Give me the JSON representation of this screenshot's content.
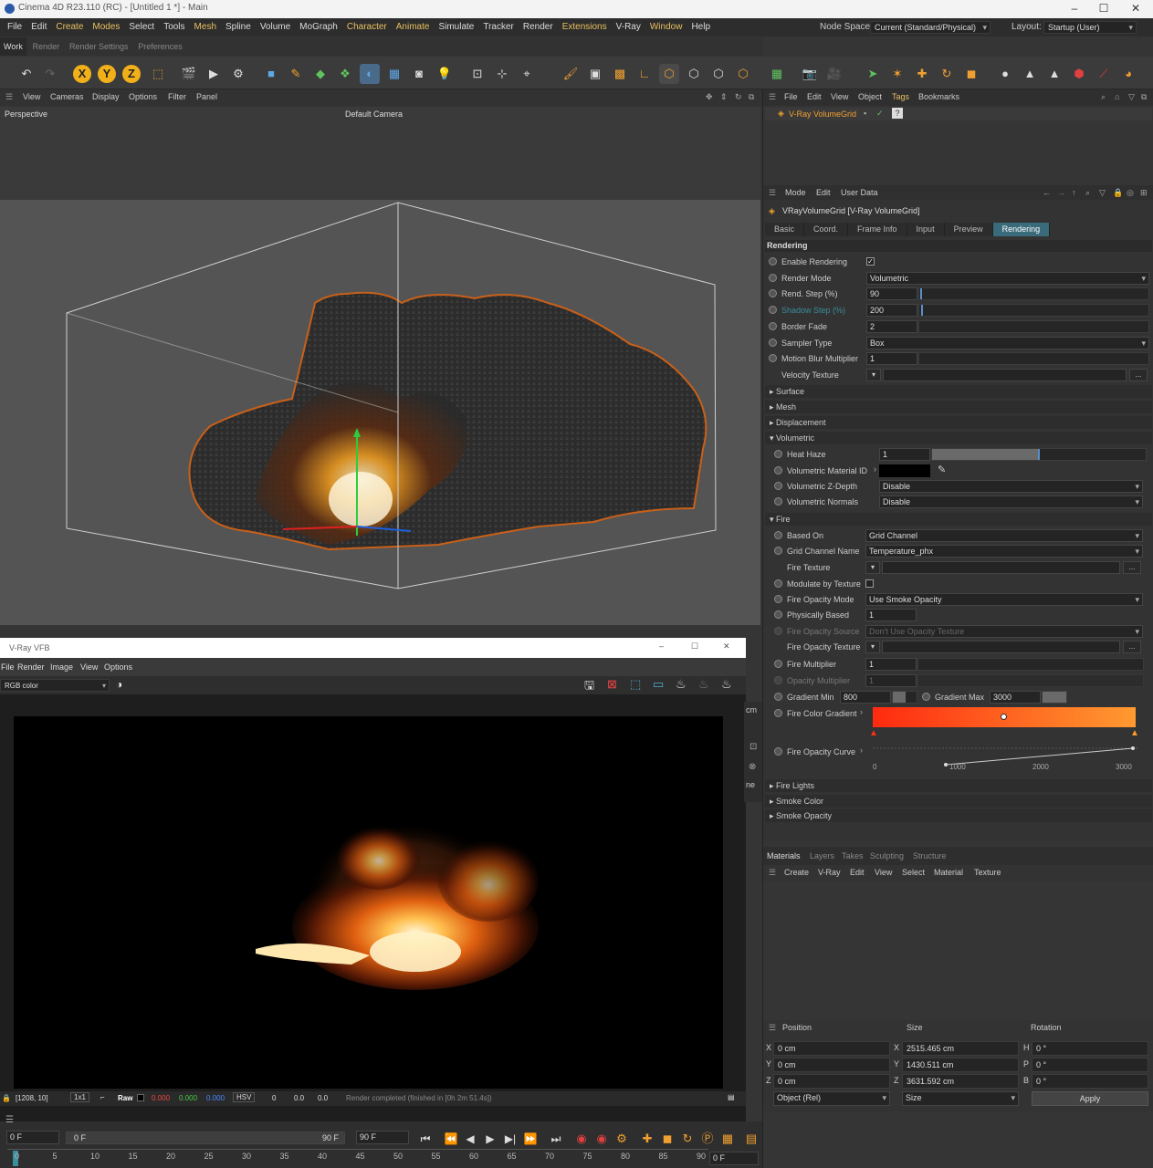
{
  "app": {
    "title": "Cinema 4D R23.110 (RC) - [Untitled 1 *] - Main"
  },
  "menubar": {
    "items": [
      "File",
      "Edit",
      "Create",
      "Modes",
      "Select",
      "Tools",
      "Mesh",
      "Spline",
      "Volume",
      "MoGraph",
      "Character",
      "Animate",
      "Simulate",
      "Tracker",
      "Render",
      "Extensions",
      "V-Ray",
      "Window",
      "Help"
    ],
    "node_space_label": "Node Space:",
    "node_space_value": "Current (Standard/Physical)",
    "layout_label": "Layout:",
    "layout_value": "Startup (User)"
  },
  "layout_tabs": [
    "Work",
    "Render",
    "Render Settings",
    "Preferences"
  ],
  "viewport": {
    "menu": [
      "View",
      "Cameras",
      "Display",
      "Options",
      "Filter",
      "Panel"
    ],
    "caption": "Perspective",
    "camera": "Default Camera"
  },
  "object_manager": {
    "menu": [
      "File",
      "Edit",
      "View",
      "Object",
      "Tags",
      "Bookmarks"
    ],
    "object_name": "V-Ray VolumeGrid"
  },
  "attributes": {
    "menu": [
      "Mode",
      "Edit",
      "User Data"
    ],
    "header": "VRayVolumeGrid [V-Ray VolumeGrid]",
    "tabs": [
      "Basic",
      "Coord.",
      "Frame Info",
      "Input",
      "Preview",
      "Rendering"
    ],
    "section": "Rendering",
    "enable_rendering": "Enable Rendering",
    "render_mode": {
      "label": "Render Mode",
      "value": "Volumetric"
    },
    "rend_step": {
      "label": "Rend. Step (%)",
      "value": "90"
    },
    "shadow_step": {
      "label": "Shadow Step (%)",
      "value": "200"
    },
    "border_fade": {
      "label": "Border Fade",
      "value": "2"
    },
    "sampler_type": {
      "label": "Sampler Type",
      "value": "Box"
    },
    "motion_blur": {
      "label": "Motion Blur Multiplier",
      "value": "1"
    },
    "velocity_texture": {
      "label": "Velocity Texture"
    },
    "subsections": [
      "Surface",
      "Mesh",
      "Displacement",
      "Volumetric"
    ],
    "heat_haze": {
      "label": "Heat Haze",
      "value": "1"
    },
    "vol_material_id": {
      "label": "Volumetric Material ID"
    },
    "vol_zdepth": {
      "label": "Volumetric Z-Depth",
      "value": "Disable"
    },
    "vol_normals": {
      "label": "Volumetric Normals",
      "value": "Disable"
    },
    "fire_section": "Fire",
    "based_on": {
      "label": "Based On",
      "value": "Grid Channel"
    },
    "grid_channel": {
      "label": "Grid Channel Name",
      "value": "Temperature_phx"
    },
    "fire_texture": {
      "label": "Fire Texture"
    },
    "modulate_texture": {
      "label": "Modulate by Texture"
    },
    "fire_opacity_mode": {
      "label": "Fire Opacity Mode",
      "value": "Use Smoke Opacity"
    },
    "physically_based": {
      "label": "Physically Based",
      "value": "1"
    },
    "fire_opacity_source": {
      "label": "Fire Opacity Source",
      "value": "Don't Use Opacity Texture"
    },
    "fire_opacity_texture": {
      "label": "Fire Opacity Texture"
    },
    "fire_multiplier": {
      "label": "Fire Multiplier",
      "value": "1"
    },
    "opacity_multiplier": {
      "label": "Opacity Multiplier",
      "value": "1"
    },
    "gradient_min": {
      "label": "Gradient Min",
      "value": "800"
    },
    "gradient_max": {
      "label": "Gradient Max",
      "value": "3000"
    },
    "fire_color_gradient": {
      "label": "Fire Color Gradient"
    },
    "fire_opacity_curve": {
      "label": "Fire Opacity Curve",
      "ticks": [
        "0",
        "1000",
        "2000",
        "3000"
      ]
    },
    "bottom_subsections": [
      "Fire Lights",
      "Smoke Color",
      "Smoke Opacity"
    ]
  },
  "materials": {
    "tabs": [
      "Materials",
      "Layers",
      "Takes",
      "Sculpting",
      "Structure"
    ],
    "menu": [
      "Create",
      "V-Ray",
      "Edit",
      "View",
      "Select",
      "Material",
      "Texture"
    ]
  },
  "coords": {
    "headers": [
      "Position",
      "Size",
      "Rotation"
    ],
    "rows": [
      {
        "p": "X",
        "pv": "0 cm",
        "s": "X",
        "sv": "2515.465 cm",
        "r": "H",
        "rv": "0 °"
      },
      {
        "p": "Y",
        "pv": "0 cm",
        "s": "Y",
        "sv": "1430.511 cm",
        "r": "P",
        "rv": "0 °"
      },
      {
        "p": "Z",
        "pv": "0 cm",
        "s": "Z",
        "sv": "3631.592 cm",
        "r": "B",
        "rv": "0 °"
      }
    ],
    "mode1": "Object (Rel)",
    "mode2": "Size",
    "apply": "Apply"
  },
  "vfb": {
    "title": "V-Ray VFB",
    "menu": [
      "File",
      "Render",
      "Image",
      "View",
      "Options"
    ],
    "channel": "RGB color",
    "status": {
      "coords": "[1208, 10]",
      "zoom": "1x1",
      "raw": "Raw",
      "r": "0.000",
      "g": "0.000",
      "b": "0.000",
      "mode": "HSV",
      "h": "0",
      "s": "0.0",
      "v": "0.0",
      "msg": "Render completed (finished in [0h  2m 51.4s])"
    }
  },
  "timeline": {
    "start": "0 F",
    "current": "0 F",
    "end_a": "90 F",
    "end_b": "90 F",
    "ticks": [
      "0",
      "5",
      "10",
      "15",
      "20",
      "25",
      "30",
      "35",
      "40",
      "45",
      "50",
      "55",
      "60",
      "65",
      "70",
      "75",
      "80",
      "85",
      "90"
    ],
    "frame": "0 F"
  },
  "colors": {
    "accent": "#3a6b7a",
    "fire_start": "#ff2a10",
    "fire_end": "#ff9a30"
  }
}
